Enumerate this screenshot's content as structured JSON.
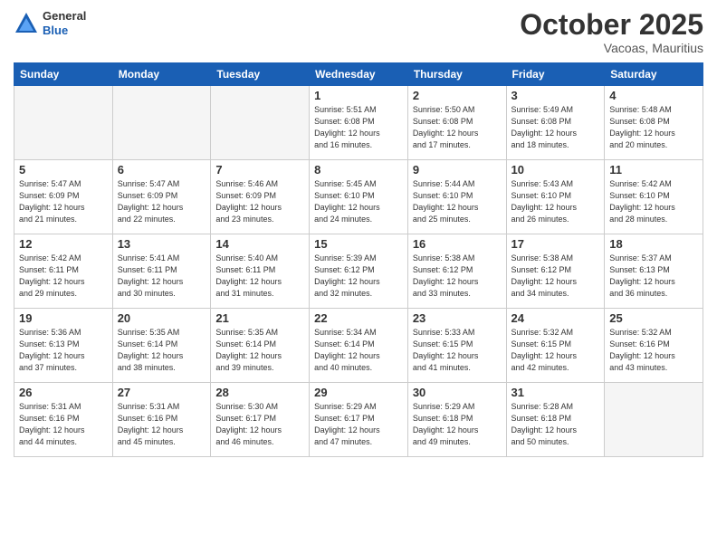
{
  "header": {
    "logo": {
      "general": "General",
      "blue": "Blue"
    },
    "month": "October 2025",
    "location": "Vacoas, Mauritius"
  },
  "weekdays": [
    "Sunday",
    "Monday",
    "Tuesday",
    "Wednesday",
    "Thursday",
    "Friday",
    "Saturday"
  ],
  "weeks": [
    [
      {
        "day": "",
        "info": ""
      },
      {
        "day": "",
        "info": ""
      },
      {
        "day": "",
        "info": ""
      },
      {
        "day": "1",
        "info": "Sunrise: 5:51 AM\nSunset: 6:08 PM\nDaylight: 12 hours\nand 16 minutes."
      },
      {
        "day": "2",
        "info": "Sunrise: 5:50 AM\nSunset: 6:08 PM\nDaylight: 12 hours\nand 17 minutes."
      },
      {
        "day": "3",
        "info": "Sunrise: 5:49 AM\nSunset: 6:08 PM\nDaylight: 12 hours\nand 18 minutes."
      },
      {
        "day": "4",
        "info": "Sunrise: 5:48 AM\nSunset: 6:08 PM\nDaylight: 12 hours\nand 20 minutes."
      }
    ],
    [
      {
        "day": "5",
        "info": "Sunrise: 5:47 AM\nSunset: 6:09 PM\nDaylight: 12 hours\nand 21 minutes."
      },
      {
        "day": "6",
        "info": "Sunrise: 5:47 AM\nSunset: 6:09 PM\nDaylight: 12 hours\nand 22 minutes."
      },
      {
        "day": "7",
        "info": "Sunrise: 5:46 AM\nSunset: 6:09 PM\nDaylight: 12 hours\nand 23 minutes."
      },
      {
        "day": "8",
        "info": "Sunrise: 5:45 AM\nSunset: 6:10 PM\nDaylight: 12 hours\nand 24 minutes."
      },
      {
        "day": "9",
        "info": "Sunrise: 5:44 AM\nSunset: 6:10 PM\nDaylight: 12 hours\nand 25 minutes."
      },
      {
        "day": "10",
        "info": "Sunrise: 5:43 AM\nSunset: 6:10 PM\nDaylight: 12 hours\nand 26 minutes."
      },
      {
        "day": "11",
        "info": "Sunrise: 5:42 AM\nSunset: 6:10 PM\nDaylight: 12 hours\nand 28 minutes."
      }
    ],
    [
      {
        "day": "12",
        "info": "Sunrise: 5:42 AM\nSunset: 6:11 PM\nDaylight: 12 hours\nand 29 minutes."
      },
      {
        "day": "13",
        "info": "Sunrise: 5:41 AM\nSunset: 6:11 PM\nDaylight: 12 hours\nand 30 minutes."
      },
      {
        "day": "14",
        "info": "Sunrise: 5:40 AM\nSunset: 6:11 PM\nDaylight: 12 hours\nand 31 minutes."
      },
      {
        "day": "15",
        "info": "Sunrise: 5:39 AM\nSunset: 6:12 PM\nDaylight: 12 hours\nand 32 minutes."
      },
      {
        "day": "16",
        "info": "Sunrise: 5:38 AM\nSunset: 6:12 PM\nDaylight: 12 hours\nand 33 minutes."
      },
      {
        "day": "17",
        "info": "Sunrise: 5:38 AM\nSunset: 6:12 PM\nDaylight: 12 hours\nand 34 minutes."
      },
      {
        "day": "18",
        "info": "Sunrise: 5:37 AM\nSunset: 6:13 PM\nDaylight: 12 hours\nand 36 minutes."
      }
    ],
    [
      {
        "day": "19",
        "info": "Sunrise: 5:36 AM\nSunset: 6:13 PM\nDaylight: 12 hours\nand 37 minutes."
      },
      {
        "day": "20",
        "info": "Sunrise: 5:35 AM\nSunset: 6:14 PM\nDaylight: 12 hours\nand 38 minutes."
      },
      {
        "day": "21",
        "info": "Sunrise: 5:35 AM\nSunset: 6:14 PM\nDaylight: 12 hours\nand 39 minutes."
      },
      {
        "day": "22",
        "info": "Sunrise: 5:34 AM\nSunset: 6:14 PM\nDaylight: 12 hours\nand 40 minutes."
      },
      {
        "day": "23",
        "info": "Sunrise: 5:33 AM\nSunset: 6:15 PM\nDaylight: 12 hours\nand 41 minutes."
      },
      {
        "day": "24",
        "info": "Sunrise: 5:32 AM\nSunset: 6:15 PM\nDaylight: 12 hours\nand 42 minutes."
      },
      {
        "day": "25",
        "info": "Sunrise: 5:32 AM\nSunset: 6:16 PM\nDaylight: 12 hours\nand 43 minutes."
      }
    ],
    [
      {
        "day": "26",
        "info": "Sunrise: 5:31 AM\nSunset: 6:16 PM\nDaylight: 12 hours\nand 44 minutes."
      },
      {
        "day": "27",
        "info": "Sunrise: 5:31 AM\nSunset: 6:16 PM\nDaylight: 12 hours\nand 45 minutes."
      },
      {
        "day": "28",
        "info": "Sunrise: 5:30 AM\nSunset: 6:17 PM\nDaylight: 12 hours\nand 46 minutes."
      },
      {
        "day": "29",
        "info": "Sunrise: 5:29 AM\nSunset: 6:17 PM\nDaylight: 12 hours\nand 47 minutes."
      },
      {
        "day": "30",
        "info": "Sunrise: 5:29 AM\nSunset: 6:18 PM\nDaylight: 12 hours\nand 49 minutes."
      },
      {
        "day": "31",
        "info": "Sunrise: 5:28 AM\nSunset: 6:18 PM\nDaylight: 12 hours\nand 50 minutes."
      },
      {
        "day": "",
        "info": ""
      }
    ]
  ]
}
